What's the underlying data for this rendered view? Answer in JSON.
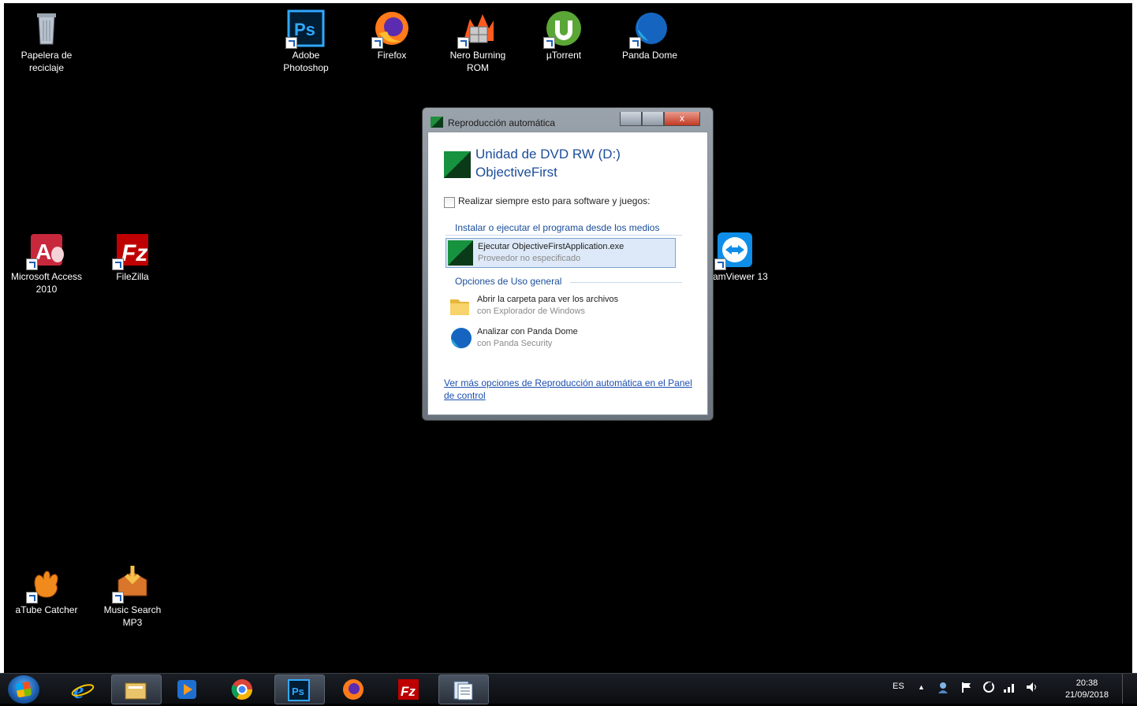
{
  "desktop": {
    "icons": [
      {
        "label": "Papelera de\nreciclaje",
        "icon": "recycle-bin-icon"
      },
      {
        "label": "Adobe\nPhotoshop",
        "icon": "photoshop-icon"
      },
      {
        "label": "Firefox",
        "icon": "firefox-icon"
      },
      {
        "label": "Nero Burning\nROM",
        "icon": "nero-icon"
      },
      {
        "label": "µTorrent",
        "icon": "utorrent-icon"
      },
      {
        "label": "Panda Dome",
        "icon": "panda-dome-icon"
      },
      {
        "label": "Microsoft Access\n2010",
        "icon": "access-icon"
      },
      {
        "label": "FileZilla",
        "icon": "filezilla-icon"
      },
      {
        "label": "amViewer 13",
        "icon": "teamviewer-icon"
      },
      {
        "label": "aTube Catcher",
        "icon": "atube-catcher-icon"
      },
      {
        "label": "Music Search\nMP3",
        "icon": "music-search-icon"
      }
    ]
  },
  "dialog": {
    "title": "Reproducción automática",
    "close_glyph": "x",
    "drive_name": "Unidad de DVD RW (D:)",
    "volume_name": "ObjectiveFirst",
    "always_do_label": "Realizar siempre esto para software y juegos:",
    "section_install": "Instalar o ejecutar el programa desde los medios",
    "run_option_title": "Ejecutar ObjectiveFirstApplication.exe",
    "run_option_sub": "Proveedor no especificado",
    "section_general": "Opciones de Uso general",
    "open_folder_title": "Abrir la carpeta para ver los archivos",
    "open_folder_sub": "con Explorador de Windows",
    "scan_title": "Analizar con Panda Dome",
    "scan_sub": "con Panda Security",
    "more_options_link": "Ver más opciones de Reproducción automática en el Panel de control"
  },
  "taskbar": {
    "apps": [
      "ie-icon",
      "explorer-icon",
      "media-player-icon",
      "chrome-icon",
      "photoshop-icon",
      "firefox-icon",
      "filezilla-icon",
      "files-icon"
    ],
    "language": "ES",
    "time": "20:38",
    "date": "21/09/2018"
  },
  "colors": {
    "desktop_bg": "#000000",
    "accent_blue": "#1a4d9a",
    "link_blue": "#1c4fb0"
  }
}
